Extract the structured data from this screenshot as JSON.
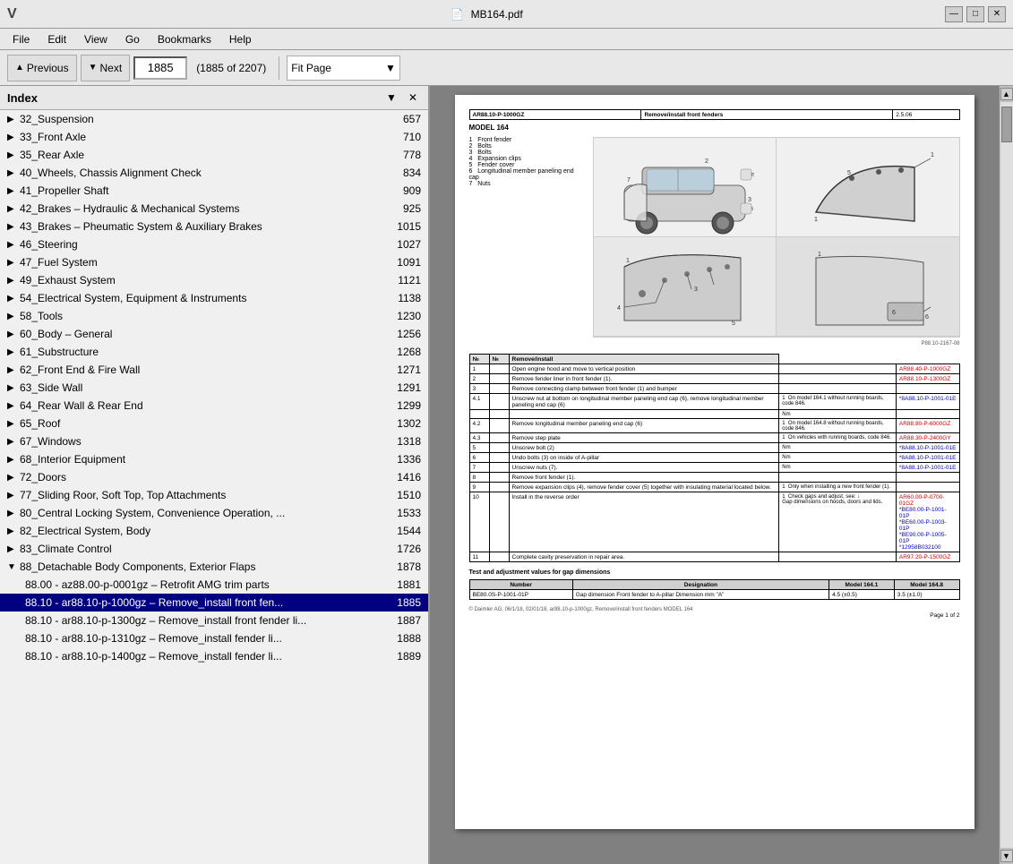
{
  "window": {
    "title": "MB164.pdf",
    "app_icon": "V"
  },
  "win_controls": {
    "minimize": "—",
    "maximize": "□",
    "close": "✕"
  },
  "menubar": {
    "items": [
      "File",
      "Edit",
      "View",
      "Go",
      "Bookmarks",
      "Help"
    ]
  },
  "toolbar": {
    "prev_label": "Previous",
    "next_label": "Next",
    "page_value": "1885",
    "page_count": "(1885 of 2207)",
    "fit_label": "Fit Page",
    "fit_arrow": "▼"
  },
  "sidebar": {
    "title": "Index",
    "collapse_icon": "▼",
    "close_icon": "✕",
    "items": [
      {
        "id": "32",
        "label": "32_Suspension",
        "page": "657",
        "expanded": false
      },
      {
        "id": "33",
        "label": "33_Front Axle",
        "page": "710",
        "expanded": false
      },
      {
        "id": "35",
        "label": "35_Rear Axle",
        "page": "778",
        "expanded": false
      },
      {
        "id": "40",
        "label": "40_Wheels, Chassis Alignment Check",
        "page": "834",
        "expanded": false
      },
      {
        "id": "41",
        "label": "41_Propeller Shaft",
        "page": "909",
        "expanded": false
      },
      {
        "id": "42",
        "label": "42_Brakes – Hydraulic & Mechanical Systems",
        "page": "925",
        "expanded": false
      },
      {
        "id": "43",
        "label": "43_Brakes – Pheumatic System & Auxiliary Brakes",
        "page": "1015",
        "expanded": false
      },
      {
        "id": "46",
        "label": "46_Steering",
        "page": "1027",
        "expanded": false
      },
      {
        "id": "47",
        "label": "47_Fuel System",
        "page": "1091",
        "expanded": false
      },
      {
        "id": "49",
        "label": "49_Exhaust System",
        "page": "1121",
        "expanded": false
      },
      {
        "id": "54",
        "label": "54_Electrical System, Equipment & Instruments",
        "page": "1138",
        "expanded": false
      },
      {
        "id": "58",
        "label": "58_Tools",
        "page": "1230",
        "expanded": false
      },
      {
        "id": "60",
        "label": "60_Body – General",
        "page": "1256",
        "expanded": false
      },
      {
        "id": "61",
        "label": "61_Substructure",
        "page": "1268",
        "expanded": false
      },
      {
        "id": "62",
        "label": "62_Front End & Fire Wall",
        "page": "1271",
        "expanded": false
      },
      {
        "id": "63",
        "label": "63_Side Wall",
        "page": "1291",
        "expanded": false
      },
      {
        "id": "64",
        "label": "64_Rear Wall & Rear End",
        "page": "1299",
        "expanded": false
      },
      {
        "id": "65",
        "label": "65_Roof",
        "page": "1302",
        "expanded": false
      },
      {
        "id": "67",
        "label": "67_Windows",
        "page": "1318",
        "expanded": false
      },
      {
        "id": "68",
        "label": "68_Interior Equipment",
        "page": "1336",
        "expanded": false
      },
      {
        "id": "72",
        "label": "72_Doors",
        "page": "1416",
        "expanded": false
      },
      {
        "id": "77",
        "label": "77_Sliding Roor, Soft Top, Top Attachments",
        "page": "1510",
        "expanded": false
      },
      {
        "id": "80",
        "label": "80_Central Locking System, Convenience Operation, ...",
        "page": "1533",
        "expanded": false
      },
      {
        "id": "82",
        "label": "82_Electrical System, Body",
        "page": "1544",
        "expanded": false
      },
      {
        "id": "83",
        "label": "83_Climate Control",
        "page": "1726",
        "expanded": false
      },
      {
        "id": "88",
        "label": "88_Detachable Body Components, Exterior Flaps",
        "page": "1878",
        "expanded": true
      }
    ],
    "subitems": [
      {
        "label": "88.00 - az88.00-p-0001gz – Retrofit AMG trim parts",
        "page": "1881"
      },
      {
        "label": "88.10 - ar88.10-p-1000gz – Remove_install front fen...",
        "page": "1885",
        "selected": true
      },
      {
        "label": "88.10 - ar88.10-p-1300gz – Remove_install front fender li...",
        "page": "1887"
      },
      {
        "label": "88.10 - ar88.10-p-1310gz – Remove_install fender li...",
        "page": "1888"
      },
      {
        "label": "88.10 - ar88.10-p-1400gz – Remove_install fender li...",
        "page": "1889"
      }
    ]
  },
  "document": {
    "header": {
      "ref": "AR88.10-P-1000GZ",
      "title": "Remove/install front fenders",
      "version": "2.5.06"
    },
    "model": "MODEL   164",
    "legend": [
      "1   Front fender",
      "2   Bolts",
      "3   Bolts",
      "4   Expansion clips",
      "5   Fender cover",
      "6   Longitudinal member paneling end cap",
      "7   Nuts"
    ],
    "caption": "P88.10-2167-08",
    "table_headers": [
      "№",
      "№",
      "Remove/install"
    ],
    "table_rows": [
      {
        "num1": "1",
        "num2": "",
        "desc": "Open engine hood and move to vertical position",
        "note": "",
        "ref": "AR88.40-P-1000GZ"
      },
      {
        "num1": "2",
        "num2": "",
        "desc": "Remove fender liner in front fender (1).",
        "note": "",
        "ref": "AR88.10-P-1300GZ"
      },
      {
        "num1": "3",
        "num2": "",
        "desc": "Remove connecting clamp between front fender (1) and bumper",
        "note": "",
        "ref": ""
      },
      {
        "num1": "4.1",
        "num2": "",
        "desc": "Unscrew nut at bottom on longitudinal member paneling end cap (6), remove longitudinal member paneling end cap (6)",
        "note": "1  On model 164.1 without running boards, code 846.",
        "ref": "*8A88.10-P-1001-01E"
      },
      {
        "num1": "",
        "num2": "",
        "desc": "",
        "note": "Nm",
        "ref": ""
      },
      {
        "num1": "4.2",
        "num2": "",
        "desc": "Remove longitudinal member paneling end cap (6)",
        "note": "1  On model 164.8 without running boards, code 846.",
        "ref": "AR88.80-P-6000GZ"
      },
      {
        "num1": "4.3",
        "num2": "",
        "desc": "Remove step plate",
        "note": "1  On vehicles with running boards, code 846.",
        "ref": "AR88.30-P-2400GY"
      },
      {
        "num1": "5",
        "num2": "",
        "desc": "Unscrew bolt (2)",
        "note": "Nm",
        "ref": "*8A88.10-P-1001-01E"
      },
      {
        "num1": "6",
        "num2": "",
        "desc": "Undo bolts (3) on inside of A-pillar",
        "note": "Nm",
        "ref": "*8A88.10-P-1001-01E"
      },
      {
        "num1": "7",
        "num2": "",
        "desc": "Unscrew nuts (7).",
        "note": "Nm",
        "ref": "*8A88.10-P-1001-01E"
      },
      {
        "num1": "8",
        "num2": "",
        "desc": "Remove front fender (1).",
        "note": "",
        "ref": ""
      },
      {
        "num1": "9",
        "num2": "",
        "desc": "Remove expansion clips (4), remove fender cover (5) together with insulating material located below.",
        "note": "1  Only when installing a new front fender (1).",
        "ref": ""
      },
      {
        "num1": "10",
        "num2": "",
        "desc": "Install in the reverse order",
        "note": "1  Check gaps and adjust, see: ↓\nGap dimensions on hoods, doors and lids.",
        "ref": "AR60.00-P-0700-01GZ\n*BE80.00-P-1001-01P\n*BE60.00-P-1003-01P\n*BE90.00-P-1005-01P\n*12958B032100"
      },
      {
        "num1": "11",
        "num2": "",
        "desc": "Complete cavity preservation in repair area.",
        "note": "",
        "ref": "AR97.20-P-1500GZ"
      }
    ],
    "gap_section_title": "Test and adjustment values for gap dimensions",
    "gap_table_headers": [
      "Number",
      "Designation",
      "Model 164.1",
      "Model 164.8"
    ],
    "gap_table_rows": [
      {
        "num": "BE80.0S-P-1001-01P",
        "desig": "Gap dimension   Front fender to A-pillar   Dimension mm \"A\"",
        "m1641": "4.5 (±0.5)",
        "m1648": "3.5 (±1.0)"
      }
    ],
    "footer": "© Daimler AG, 06/1/18, 02/01/18, ar88.10-p-1000gz, Remove/install front fenders\nMODEL 164",
    "page_label": "Page 1 of 2"
  }
}
